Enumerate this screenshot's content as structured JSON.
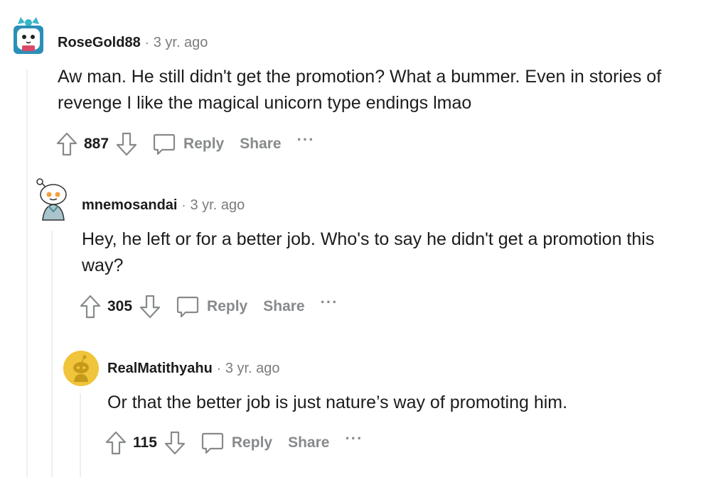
{
  "comments": [
    {
      "author": "RoseGold88",
      "separator": "·",
      "time": "3 yr. ago",
      "text": "Aw man. He still didn't get the promotion? What a bummer. Even in stories of revenge I like the magical unicorn type endings lmao",
      "score": "887",
      "reply_label": "Reply",
      "share_label": "Share",
      "more_label": "···",
      "avatar_icon": "cat-avatar-icon"
    },
    {
      "author": "mnemosandai",
      "separator": "·",
      "time": "3 yr. ago",
      "text": "Hey, he left or for a better job. Who's to say he didn't get a promotion this way?",
      "score": "305",
      "reply_label": "Reply",
      "share_label": "Share",
      "more_label": "···",
      "avatar_icon": "snoo-avatar-icon"
    },
    {
      "author": "RealMatithyahu",
      "separator": "·",
      "time": "3 yr. ago",
      "text": "Or that the better job is just nature’s way of promoting him.",
      "score": "115",
      "reply_label": "Reply",
      "share_label": "Share",
      "more_label": "···",
      "avatar_icon": "default-snoo-avatar-icon"
    }
  ],
  "colors": {
    "text": "#1c1c1c",
    "muted": "#878a8c",
    "thread_line": "#edeff1",
    "avatar_yellow": "#f0c43b"
  }
}
